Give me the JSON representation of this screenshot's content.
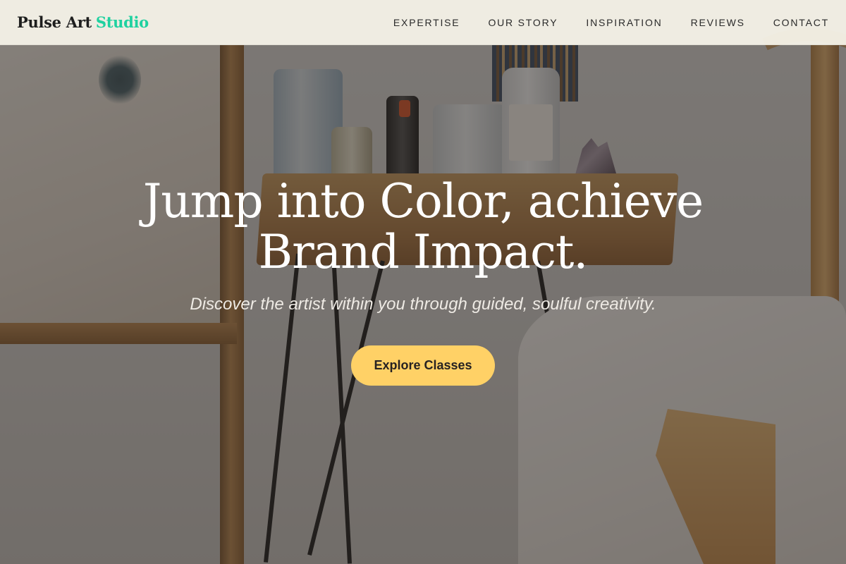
{
  "nav": {
    "brand": {
      "main": "Pulse Art",
      "accent": "Studio",
      "accent_color": "#1fd1a0"
    },
    "links": [
      {
        "label": "EXPERTISE"
      },
      {
        "label": "OUR STORY"
      },
      {
        "label": "INSPIRATION"
      },
      {
        "label": "REVIEWS"
      },
      {
        "label": "CONTACT"
      }
    ]
  },
  "hero": {
    "title": "Jump into Color, achieve Brand Impact.",
    "subtitle": "Discover the artist within you through guided, soulful creativity.",
    "cta_label": "Explore Classes",
    "cta_color": "#ffd166",
    "background_image": "art-studio-photo"
  }
}
